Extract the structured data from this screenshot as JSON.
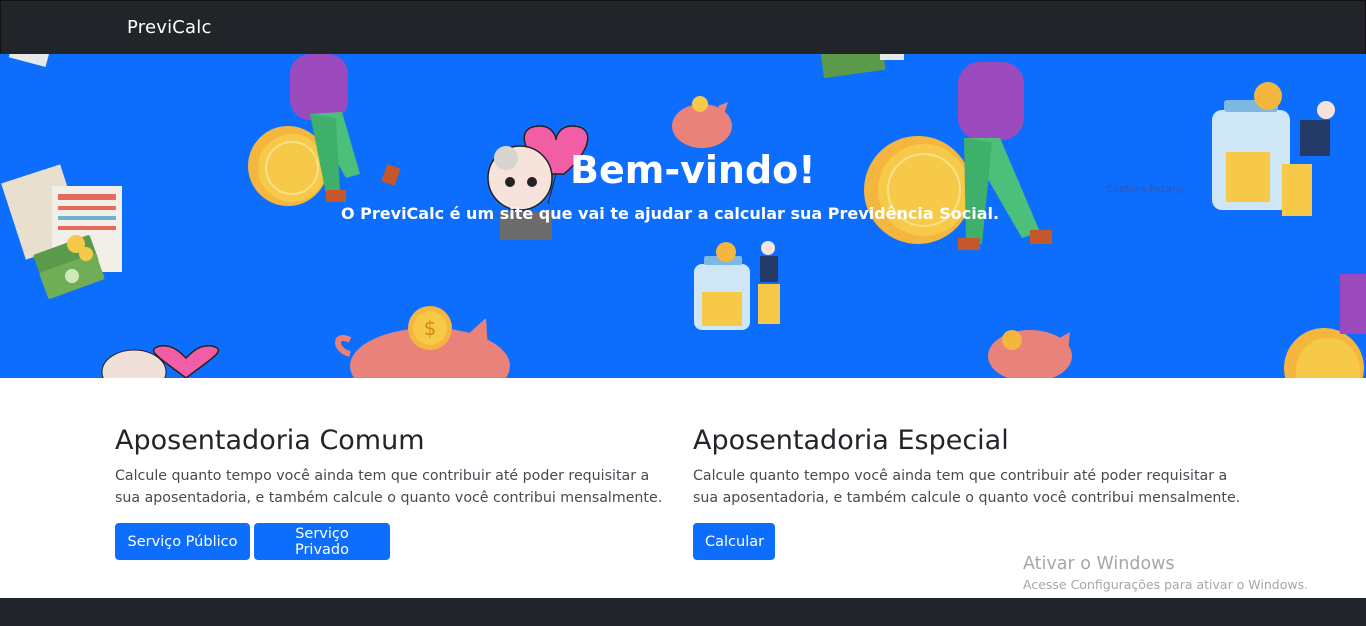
{
  "navbar": {
    "brand": "PreviCalc"
  },
  "hero": {
    "title": "Bem-vindo!",
    "subtitle": "O PreviCalc é um site que vai te ajudar a calcular sua Previdência Social.",
    "overlay_text": "Captura Retang"
  },
  "sections": [
    {
      "title": "Aposentadoria Comum",
      "description": "Calcule quanto tempo você ainda tem que contribuir até poder requisitar a sua aposentadoria, e também calcule o quanto você contribui mensalmente.",
      "buttons": [
        "Serviço Público",
        "Serviço Privado"
      ]
    },
    {
      "title": "Aposentadoria Especial",
      "description": "Calcule quanto tempo você ainda tem que contribuir até poder requisitar a sua aposentadoria, e também calcule o quanto você contribui mensalmente.",
      "buttons": [
        "Calcular"
      ]
    }
  ],
  "windows_activation": {
    "title": "Ativar o Windows",
    "message": "Acesse Configurações para ativar o Windows."
  },
  "colors": {
    "navbar": "#212529",
    "hero_background": "#0d6efd",
    "button": "#0d6efd",
    "coin": "#f7c948",
    "pig": "#e8827a",
    "heart": "#f25ea6",
    "shirt": "#9b4bbd",
    "pants": "#4cc07a"
  },
  "icons": [
    "coin-icon",
    "piggy-bank-icon",
    "money-bill-icon",
    "coin-jar-icon",
    "document-icon",
    "heart-balloon-icon",
    "person-illustration"
  ]
}
